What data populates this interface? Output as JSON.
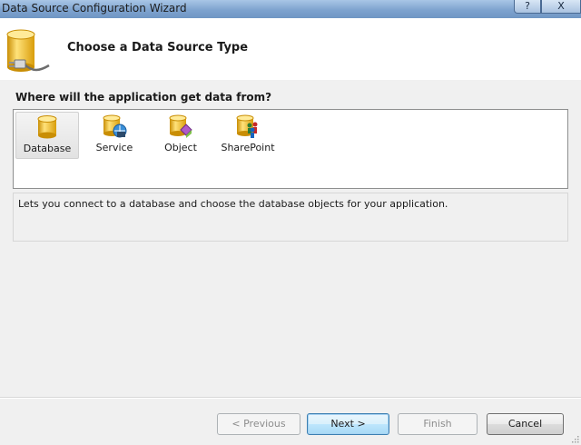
{
  "window": {
    "title": "Data Source Configuration Wizard",
    "help_label": "?",
    "close_label": "X"
  },
  "header": {
    "title": "Choose a Data Source Type",
    "icon": "database-plug-icon"
  },
  "question": "Where will the application get data from?",
  "types": [
    {
      "label": "Database",
      "icon": "database-icon",
      "selected": true
    },
    {
      "label": "Service",
      "icon": "service-icon",
      "selected": false
    },
    {
      "label": "Object",
      "icon": "object-icon",
      "selected": false
    },
    {
      "label": "SharePoint",
      "icon": "sharepoint-icon",
      "selected": false
    }
  ],
  "description": "Lets you connect to a database and choose the database objects for your application.",
  "buttons": {
    "previous": "< Previous",
    "next": "Next >",
    "finish": "Finish",
    "cancel": "Cancel"
  },
  "colors": {
    "cylinder_gold": "#e8b012",
    "cylinder_light": "#ffe27a",
    "default_button_border": "#3c7fb1"
  }
}
